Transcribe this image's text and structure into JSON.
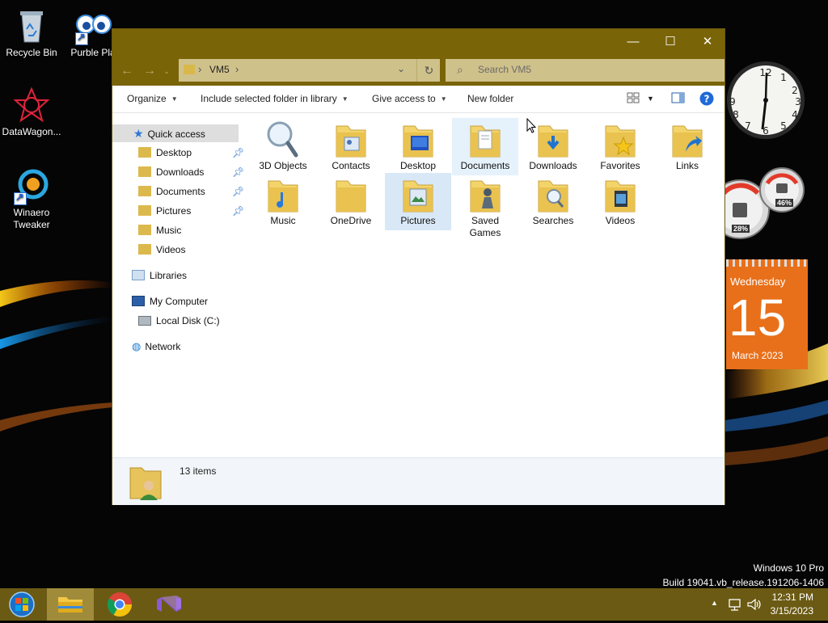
{
  "desktop": {
    "icons": [
      {
        "label": "Recycle Bin"
      },
      {
        "label": "Purble Pla"
      },
      {
        "label": "DataWagon..."
      },
      {
        "label": "Winaero Tweaker"
      }
    ],
    "watermark_line1": "Windows 10 Pro",
    "watermark_line2": "Build 19041.vb_release.191206-1406"
  },
  "gadgets": {
    "calendar": {
      "weekday": "Wednesday",
      "day": "15",
      "month_year": "March 2023"
    },
    "meter": {
      "cpu": "28%",
      "memory": "46%",
      "cpu_level": 0.28,
      "memory_level": 0.46
    }
  },
  "window": {
    "controls": {
      "minimize": "—",
      "maximize": "☐",
      "close": "✕"
    },
    "address": {
      "location": "VM5",
      "separator": "›"
    },
    "search": {
      "placeholder": "Search VM5"
    },
    "commands": {
      "organize": "Organize",
      "include": "Include selected folder in library",
      "give_access": "Give access to",
      "new_folder": "New folder"
    },
    "nav": {
      "quick_access": "Quick access",
      "pinned": [
        "Desktop",
        "Downloads",
        "Documents",
        "Pictures"
      ],
      "others": [
        "Music",
        "Videos"
      ],
      "libraries": "Libraries",
      "my_computer": "My Computer",
      "local_disk": "Local Disk (C:)",
      "network": "Network"
    },
    "files": [
      {
        "label": "3D Objects",
        "icon": "magnifier-icon"
      },
      {
        "label": "Contacts",
        "icon": "contacts-folder-icon"
      },
      {
        "label": "Desktop",
        "icon": "desktop-folder-icon"
      },
      {
        "label": "Documents",
        "icon": "documents-folder-icon"
      },
      {
        "label": "Downloads",
        "icon": "downloads-folder-icon"
      },
      {
        "label": "Favorites",
        "icon": "favorites-folder-icon"
      },
      {
        "label": "Links",
        "icon": "links-folder-icon"
      },
      {
        "label": "Music",
        "icon": "music-folder-icon"
      },
      {
        "label": "OneDrive",
        "icon": "onedrive-folder-icon"
      },
      {
        "label": "Pictures",
        "icon": "pictures-folder-icon"
      },
      {
        "label": "Saved Games",
        "icon": "saved-games-folder-icon"
      },
      {
        "label": "Searches",
        "icon": "searches-folder-icon"
      },
      {
        "label": "Videos",
        "icon": "videos-folder-icon"
      }
    ],
    "status": {
      "item_count": "13 items"
    }
  },
  "taskbar": {
    "time": "12:31 PM",
    "date": "3/15/2023",
    "tray_arrow": "▲"
  },
  "colors": {
    "accent": "#7a6408",
    "taskbar": "#6b5a13",
    "selection": "#d9e8f7"
  }
}
